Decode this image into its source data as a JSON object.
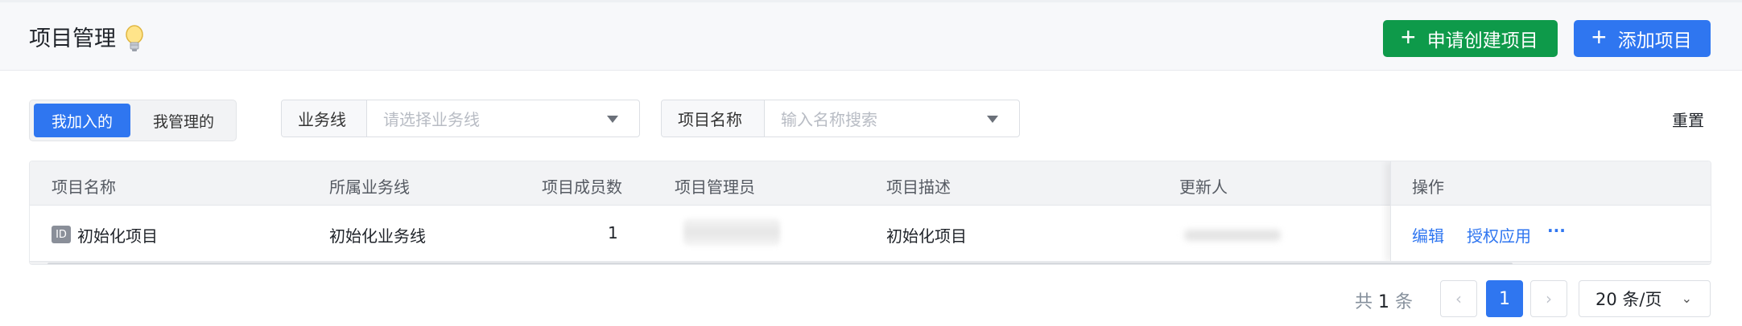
{
  "header": {
    "title": "项目管理",
    "apply_button": "申请创建项目",
    "add_button": "添加项目"
  },
  "tabs": {
    "joined": "我加入的",
    "managed": "我管理的"
  },
  "filters": {
    "business_line": {
      "label": "业务线",
      "placeholder": "请选择业务线"
    },
    "project_name": {
      "label": "项目名称",
      "placeholder": "输入名称搜索"
    },
    "reset": "重置"
  },
  "table": {
    "columns": [
      "项目名称",
      "所属业务线",
      "项目成员数",
      "项目管理员",
      "项目描述",
      "更新人",
      "操作"
    ],
    "rows": [
      {
        "badge": "ID",
        "name": "初始化项目",
        "business_line": "初始化业务线",
        "members": "1",
        "description": "初始化项目",
        "actions": {
          "edit": "编辑",
          "authorize": "授权应用",
          "more": "···"
        }
      }
    ]
  },
  "pagination": {
    "total_prefix": "共",
    "total_count": "1",
    "total_suffix": "条",
    "prev": "‹",
    "current_page": "1",
    "next": "›",
    "page_size": "20 条/页"
  }
}
